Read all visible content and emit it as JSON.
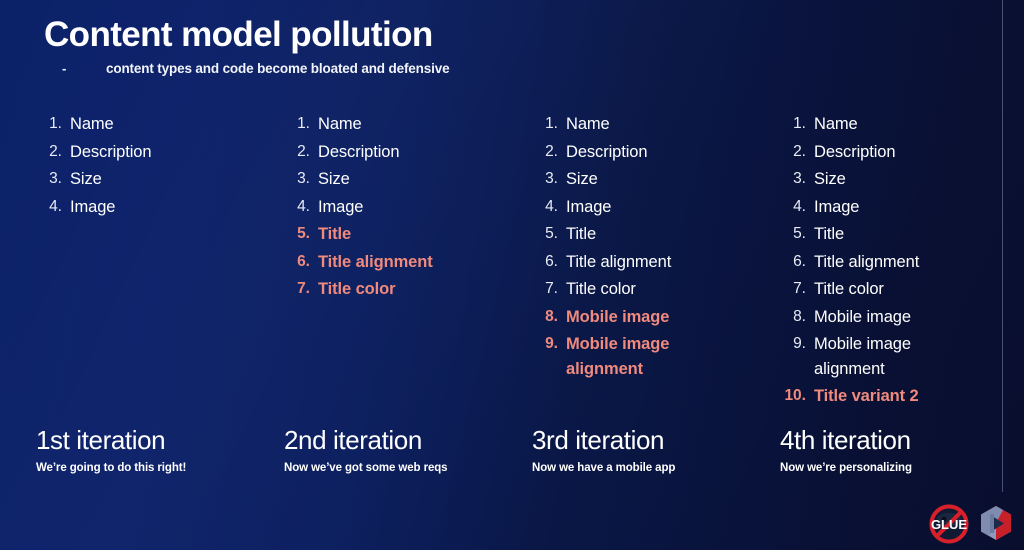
{
  "slide": {
    "title": "Content model pollution",
    "subtitle_dash": "-",
    "subtitle": "content types and code become bloated and defensive",
    "background_gradient_from": "#0b2168",
    "background_gradient_to": "#0a1033",
    "highlight_color": "#ef8a7d",
    "text_color": "#ffffff"
  },
  "columns": [
    {
      "id": "iteration-1",
      "items": [
        {
          "num": "1.",
          "label": "Name",
          "highlight": false
        },
        {
          "num": "2.",
          "label": "Description",
          "highlight": false
        },
        {
          "num": "3.",
          "label": "Size",
          "highlight": false
        },
        {
          "num": "4.",
          "label": "Image",
          "highlight": false
        }
      ],
      "caption_title": "1st iteration",
      "caption_sub": "We’re going to do this right!"
    },
    {
      "id": "iteration-2",
      "items": [
        {
          "num": "1.",
          "label": "Name",
          "highlight": false
        },
        {
          "num": "2.",
          "label": "Description",
          "highlight": false
        },
        {
          "num": "3.",
          "label": "Size",
          "highlight": false
        },
        {
          "num": "4.",
          "label": "Image",
          "highlight": false
        },
        {
          "num": "5.",
          "label": "Title",
          "highlight": true
        },
        {
          "num": "6.",
          "label": "Title alignment",
          "highlight": true
        },
        {
          "num": "7.",
          "label": "Title color",
          "highlight": true
        }
      ],
      "caption_title": "2nd iteration",
      "caption_sub": "Now we’ve got some web reqs"
    },
    {
      "id": "iteration-3",
      "items": [
        {
          "num": "1.",
          "label": "Name",
          "highlight": false
        },
        {
          "num": "2.",
          "label": "Description",
          "highlight": false
        },
        {
          "num": "3.",
          "label": "Size",
          "highlight": false
        },
        {
          "num": "4.",
          "label": "Image",
          "highlight": false
        },
        {
          "num": "5.",
          "label": "Title",
          "highlight": false
        },
        {
          "num": "6.",
          "label": "Title alignment",
          "highlight": false
        },
        {
          "num": "7.",
          "label": "Title color",
          "highlight": false
        },
        {
          "num": "8.",
          "label": "Mobile image",
          "highlight": true
        },
        {
          "num": "9.",
          "label": "Mobile image alignment",
          "highlight": true
        }
      ],
      "caption_title": "3rd iteration",
      "caption_sub": "Now we have a mobile app"
    },
    {
      "id": "iteration-4",
      "items": [
        {
          "num": "1.",
          "label": "Name",
          "highlight": false
        },
        {
          "num": "2.",
          "label": "Description",
          "highlight": false
        },
        {
          "num": "3.",
          "label": "Size",
          "highlight": false
        },
        {
          "num": "4.",
          "label": "Image",
          "highlight": false
        },
        {
          "num": "5.",
          "label": "Title",
          "highlight": false
        },
        {
          "num": "6.",
          "label": "Title alignment",
          "highlight": false
        },
        {
          "num": "7.",
          "label": "Title color",
          "highlight": false
        },
        {
          "num": "8.",
          "label": "Mobile image",
          "highlight": false
        },
        {
          "num": "9.",
          "label": "Mobile image alignment",
          "highlight": false
        },
        {
          "num": "10.",
          "label": "Title variant 2",
          "highlight": true
        }
      ],
      "caption_title": "4th iteration",
      "caption_sub": "Now we’re personalizing"
    }
  ],
  "logos": [
    {
      "name": "no-glue-logo",
      "text": "GLUE"
    },
    {
      "name": "hexagon-play-logo",
      "text": ""
    }
  ]
}
